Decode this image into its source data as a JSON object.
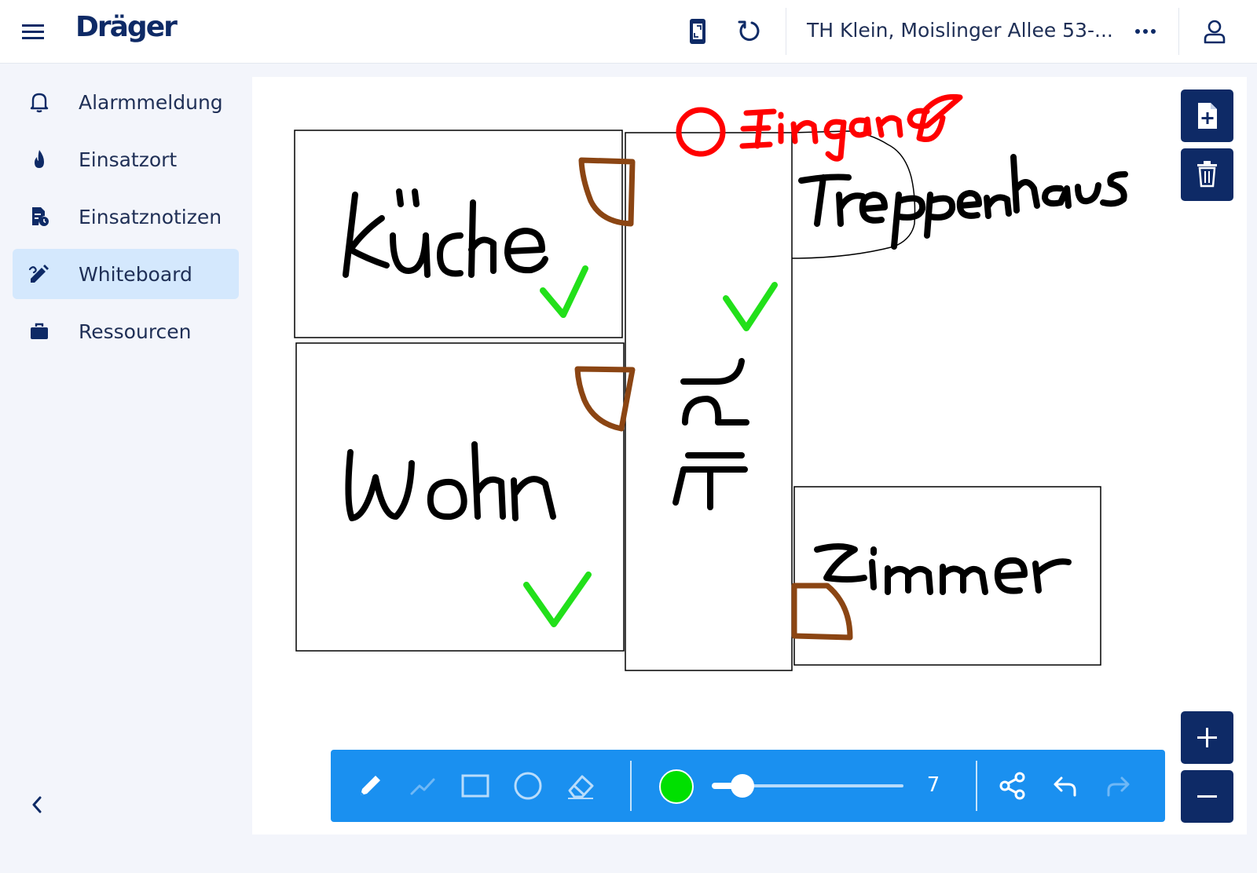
{
  "header": {
    "logo": "Dräger",
    "location": "TH Klein, Moislinger Allee 53-...",
    "icons": [
      "menu-icon",
      "tablet-icon",
      "refresh-icon",
      "more-icon",
      "user-icon"
    ]
  },
  "sidebar": {
    "items": [
      {
        "label": "Alarmmeldung",
        "icon": "bell-icon"
      },
      {
        "label": "Einsatzort",
        "icon": "flame-icon"
      },
      {
        "label": "Einsatznotizen",
        "icon": "notes-icon"
      },
      {
        "label": "Whiteboard",
        "icon": "whiteboard-edit-icon",
        "active": true
      },
      {
        "label": "Ressourcen",
        "icon": "briefcase-icon"
      }
    ],
    "collapse_icon": "chevron-left-icon"
  },
  "whiteboard": {
    "labels": [
      "Küche",
      "Wohn",
      "Flur",
      "Treppenhaus",
      "Zimmer",
      "Eingang"
    ],
    "stroke_colors": {
      "walls": "#000000",
      "text": "#000000",
      "doors": "#8b4513",
      "checks": "#22e01a",
      "entrance": "#ff0000"
    }
  },
  "side_actions": {
    "new_page_icon": "file-plus-icon",
    "delete_icon": "trash-icon",
    "zoom_in_icon": "plus-icon",
    "zoom_out_icon": "minus-icon"
  },
  "toolbar": {
    "tools": [
      "pencil-icon",
      "polyline-icon",
      "rectangle-icon",
      "circle-icon",
      "eraser-icon"
    ],
    "color": "#00e000",
    "stroke_size": "7",
    "stroke_size_fraction": 0.16,
    "actions": [
      "share-icon",
      "undo-icon",
      "redo-icon"
    ]
  },
  "colors": {
    "brand": "#0e2a66",
    "accent": "#1a90f0",
    "active_nav": "#d4e8fd",
    "background": "#f3f5fb"
  }
}
